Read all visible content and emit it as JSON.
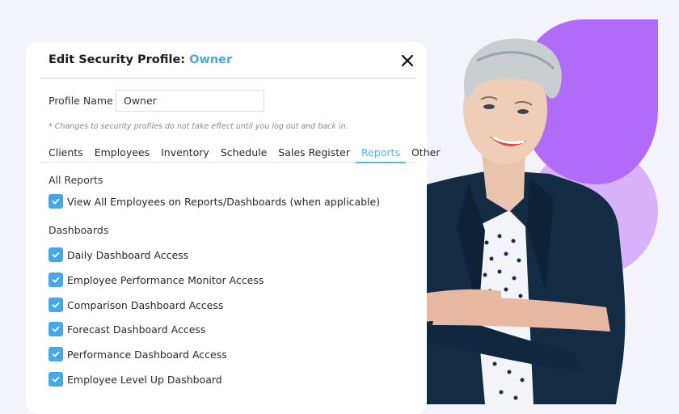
{
  "colors": {
    "accent": "#47a9e1",
    "checkbox": "#46a8e6",
    "deco_dark_purple": "#b06cf8",
    "deco_light_purple": "#d8b1fb",
    "background": "#f3f3fb"
  },
  "dialog": {
    "title_prefix": "Edit Security Profile: ",
    "title_profile": "Owner",
    "close_icon": "close-icon",
    "profile_name_label": "Profile Name",
    "profile_name_value": "Owner",
    "note": "* Changes to security profiles do not take effect until you log out and back in.",
    "tabs": [
      {
        "label": "Clients",
        "active": false
      },
      {
        "label": "Employees",
        "active": false
      },
      {
        "label": "Inventory",
        "active": false
      },
      {
        "label": "Schedule",
        "active": false
      },
      {
        "label": "Sales Register",
        "active": false
      },
      {
        "label": "Reports",
        "active": true
      },
      {
        "label": "Other",
        "active": false
      }
    ],
    "sections": [
      {
        "label": "All Reports",
        "items": [
          {
            "label": "View All Employees on Reports/Dashboards (when applicable)",
            "checked": true
          }
        ]
      },
      {
        "label": "Dashboards",
        "items": [
          {
            "label": "Daily Dashboard Access",
            "checked": true
          },
          {
            "label": "Employee Performance Monitor Access",
            "checked": true
          },
          {
            "label": "Comparison Dashboard Access",
            "checked": true
          },
          {
            "label": "Forecast Dashboard Access",
            "checked": true
          },
          {
            "label": "Performance Dashboard Access",
            "checked": true
          },
          {
            "label": "Employee Level Up Dashboard",
            "checked": true
          }
        ]
      }
    ]
  },
  "illustration": {
    "subject": "smiling woman with short grey hair in navy blazer, arms crossed"
  }
}
